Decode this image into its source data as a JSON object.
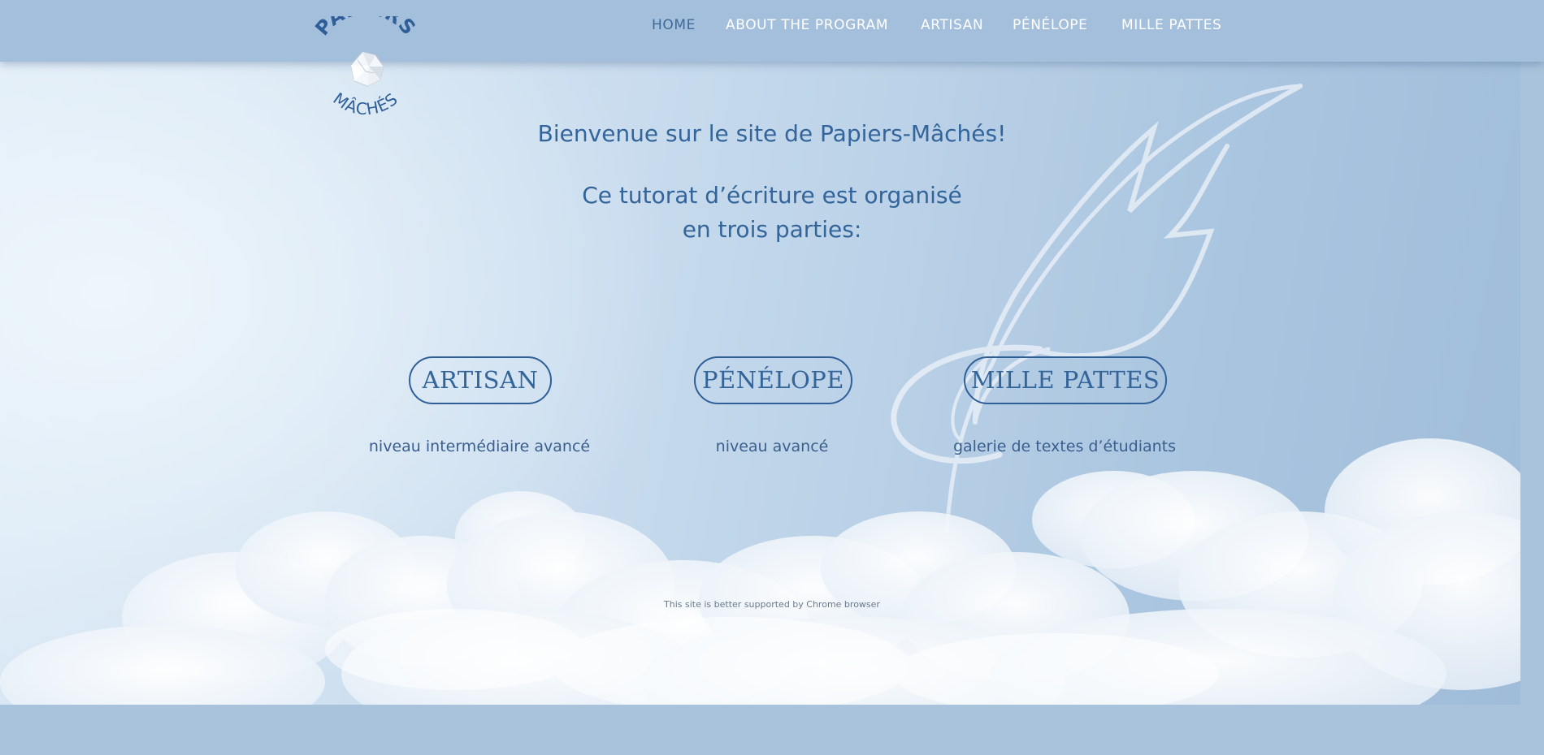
{
  "nav": {
    "items": [
      {
        "label": "HOME",
        "active": true
      },
      {
        "label": "ABOUT THE PROGRAM",
        "active": false
      },
      {
        "label": "ARTISAN",
        "active": false
      },
      {
        "label": "PÉNÉLOPE",
        "active": false
      },
      {
        "label": "MILLE PATTES",
        "active": false
      }
    ]
  },
  "logo": {
    "top_text": "PAPIERS",
    "bottom_text": "MÂCHÉS",
    "icon": "crumpled-paper-icon"
  },
  "main": {
    "welcome": "Bienvenue sur le site de Papiers-Mâchés!",
    "intro_line1": "Ce tutorat d’écriture est organisé",
    "intro_line2": "en trois parties:",
    "sections": [
      {
        "button": "ARTISAN",
        "caption": "niveau intermédiaire avancé"
      },
      {
        "button": "PÉNÉLOPE",
        "caption": "niveau avancé"
      },
      {
        "button": "MILLE PATTES",
        "caption": "galerie de textes d’étudiants"
      }
    ]
  },
  "footer": {
    "note": "This site is better supported by Chrome browser"
  },
  "colors": {
    "accent": "#33649a",
    "navbar": "#a3bfdb",
    "nav_text": "#ffffff",
    "nav_active": "#3d6b9a"
  }
}
